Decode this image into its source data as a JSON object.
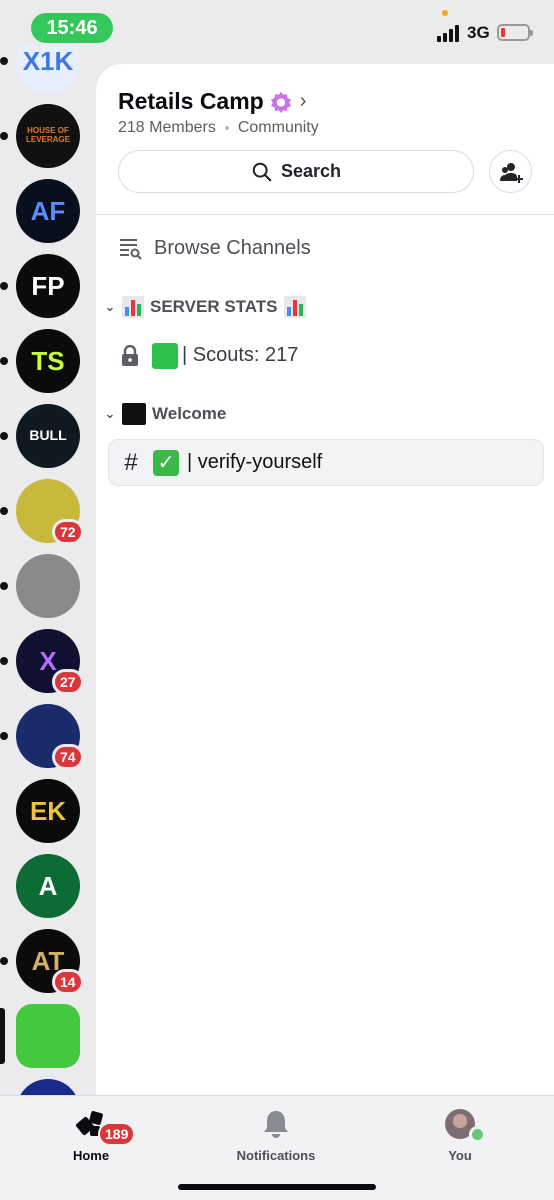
{
  "status_bar": {
    "time": "15:46",
    "network": "3G"
  },
  "server_rail": [
    {
      "name": "X1K",
      "text": "X1K",
      "bg": "#e8eefc",
      "fg": "#3c78e6",
      "unread": true
    },
    {
      "name": "House of Leverage",
      "text": "HOUSE OF LEVERAGE",
      "bg": "#111111",
      "fg": "#e07a2c",
      "unread": true
    },
    {
      "name": "AF",
      "text": "AF",
      "bg": "#0a0f1e",
      "fg": "#5b8cff",
      "unread": false
    },
    {
      "name": "FP",
      "text": "FP",
      "bg": "#0b0b0b",
      "fg": "#ffffff",
      "unread": true
    },
    {
      "name": "TS",
      "text": "TS",
      "bg": "#0b0b0b",
      "fg": "#c8ff3c",
      "unread": true
    },
    {
      "name": "Bull",
      "text": "BULL",
      "bg": "#101820",
      "fg": "#ffffff",
      "unread": true
    },
    {
      "name": "Gold",
      "text": "",
      "bg": "#c8b83c",
      "fg": "#ffffff",
      "unread": true,
      "badge": "72"
    },
    {
      "name": "Sketch",
      "text": "",
      "bg": "#8a8a8a",
      "fg": "#ffffff",
      "unread": true
    },
    {
      "name": "X",
      "text": "X",
      "bg": "#101030",
      "fg": "#b56cff",
      "unread": true,
      "badge": "27"
    },
    {
      "name": "Network",
      "text": "",
      "bg": "#1a2a6a",
      "fg": "#ffffff",
      "unread": true,
      "badge": "74"
    },
    {
      "name": "EK",
      "text": "EK",
      "bg": "#0b0b0b",
      "fg": "#f0c040",
      "unread": false
    },
    {
      "name": "A",
      "text": "A",
      "bg": "#0d6b36",
      "fg": "#ffffff",
      "unread": false
    },
    {
      "name": "AT",
      "text": "AT",
      "bg": "#0b0b0b",
      "fg": "#d4b062",
      "unread": true,
      "badge": "14"
    },
    {
      "name": "Swirl",
      "text": "",
      "bg": "#42c83c",
      "fg": "#ffffff",
      "unread": false,
      "selected": true
    },
    {
      "name": "Next",
      "text": "",
      "bg": "#1a2a8a",
      "fg": "#ffffff",
      "unread": false
    }
  ],
  "server": {
    "name": "Retails Camp",
    "members": "218 Members",
    "type": "Community"
  },
  "search": {
    "label": "Search"
  },
  "browse_channels": "Browse Channels",
  "categories": [
    {
      "title": "SERVER STATS",
      "channels": [
        {
          "label": "| Scouts: 217",
          "kind": "locked-voice"
        }
      ]
    },
    {
      "title": "Welcome",
      "channels": [
        {
          "label": "| verify-yourself",
          "kind": "text",
          "selected": true
        }
      ]
    }
  ],
  "tabs": [
    {
      "label": "Home",
      "badge": "189"
    },
    {
      "label": "Notifications"
    },
    {
      "label": "You"
    }
  ],
  "colors": {
    "accent_green": "#34c759",
    "badge_red": "#da373c",
    "presence_green": "#62c77b",
    "boost_pink": "#c975e8"
  }
}
